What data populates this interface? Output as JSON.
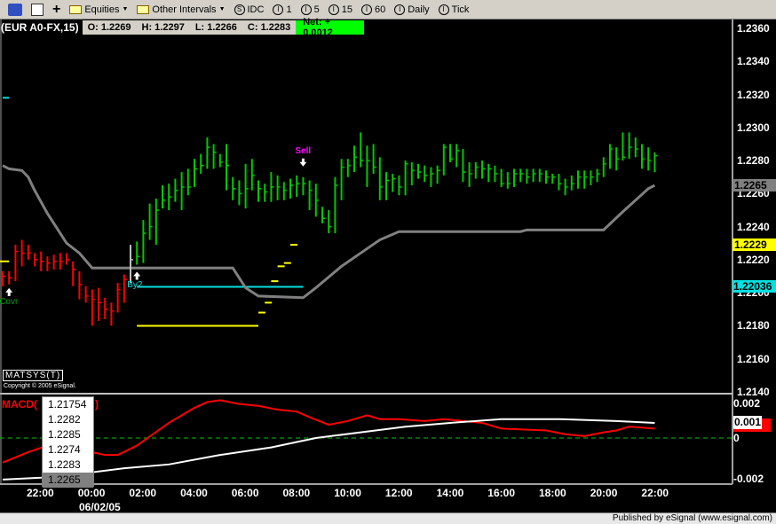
{
  "toolbar": {
    "items": [
      {
        "icon": "link-icon",
        "label": ""
      },
      {
        "icon": "properties-icon",
        "label": ""
      },
      {
        "icon": "plus-icon",
        "label": "+"
      },
      {
        "icon": "folder-icon",
        "label": "Equities",
        "dropdown": true
      },
      {
        "icon": "folder-icon",
        "label": "Other Intervals",
        "dropdown": true
      },
      {
        "icon": "circle-s-icon",
        "glyph": "S",
        "label": "IDC"
      },
      {
        "icon": "circle-i-icon",
        "glyph": "I",
        "label": "1"
      },
      {
        "icon": "circle-i-icon",
        "glyph": "I",
        "label": "5"
      },
      {
        "icon": "circle-i-icon",
        "glyph": "I",
        "label": "15"
      },
      {
        "icon": "circle-i-icon",
        "glyph": "I",
        "label": "60"
      },
      {
        "icon": "circle-i-icon",
        "glyph": "I",
        "label": "Daily"
      },
      {
        "icon": "circle-i-icon",
        "glyph": "I",
        "label": "Tick"
      }
    ]
  },
  "header": {
    "symbol": "(EUR A0-FX,15)",
    "open": "O:  1.2269",
    "high": "H:  1.2297",
    "low": "L:  1.2266",
    "close": "C:  1.2283",
    "net": "Net: + 0.0012"
  },
  "study_label": "MATSYS(T)",
  "copyright": "Copyright © 2005 eSignal.",
  "macd_label_start": "MACD(",
  "macd_label_end": ")",
  "popup": {
    "items": [
      "1.21754",
      "1.2282",
      "1.2285",
      "1.2274",
      "1.2283",
      "1.2265"
    ],
    "selected": 5
  },
  "status": "Published by eSignal (www.esignal.com)",
  "colors": {
    "up": "#00c800",
    "down": "#ff0000",
    "neutral": "#c0c0c0",
    "stop": "#808080",
    "cyan": "#00e0e0",
    "yellow": "#ffff00",
    "macd": "#ff0000",
    "signal": "#ffffff",
    "zero": "#00c800"
  },
  "chart_data": [
    {
      "type": "ohlc",
      "interval": "15",
      "bar_start": "06/01 20:30",
      "price_axis": {
        "ylim": [
          1.214,
          1.236
        ],
        "ticks": [
          "1.2360",
          "1.2340",
          "1.2320",
          "1.2300",
          "1.2280",
          "1.2260",
          "1.2240",
          "1.2220",
          "1.2200",
          "1.2180",
          "1.2160",
          "1.2140"
        ]
      },
      "time_axis": {
        "ticks": [
          "22:00",
          "00:00",
          "02:00",
          "04:00",
          "06:00",
          "08:00",
          "10:00",
          "12:00",
          "14:00",
          "16:00",
          "18:00",
          "20:00",
          "22:00"
        ],
        "date_label": "06/02/05"
      },
      "bars": [
        [
          1.2213,
          1.2204,
          1.221
        ],
        [
          1.2213,
          1.2205,
          1.2209
        ],
        [
          1.2229,
          1.2207,
          1.2225
        ],
        [
          1.2232,
          1.2216,
          1.2224
        ],
        [
          1.2229,
          1.222,
          1.2224
        ],
        [
          1.2224,
          1.2216,
          1.222
        ],
        [
          1.2225,
          1.2213,
          1.2219
        ],
        [
          1.2222,
          1.2213,
          1.2218
        ],
        [
          1.2223,
          1.2214,
          1.2219
        ],
        [
          1.2224,
          1.2214,
          1.2219
        ],
        [
          1.2224,
          1.2217,
          1.222
        ],
        [
          1.2219,
          1.2204,
          1.2214
        ],
        [
          1.2213,
          1.2196,
          1.2205
        ],
        [
          1.2204,
          1.2194,
          1.2198
        ],
        [
          1.2202,
          1.218,
          1.2196
        ],
        [
          1.2203,
          1.2183,
          1.2194
        ],
        [
          1.2197,
          1.2184,
          1.219
        ],
        [
          1.2194,
          1.218,
          1.2189
        ],
        [
          1.2206,
          1.2188,
          1.2202
        ],
        [
          1.2211,
          1.2194,
          1.2208
        ],
        [
          1.2229,
          1.2206,
          1.222
        ],
        [
          1.2231,
          1.2217,
          1.2222
        ],
        [
          1.2244,
          1.2218,
          1.2236
        ],
        [
          1.2254,
          1.2232,
          1.224
        ],
        [
          1.2257,
          1.2229,
          1.225
        ],
        [
          1.2265,
          1.2251,
          1.2256
        ],
        [
          1.2266,
          1.225,
          1.2258
        ],
        [
          1.2269,
          1.2255,
          1.2262
        ],
        [
          1.2273,
          1.225,
          1.2264
        ],
        [
          1.2275,
          1.2259,
          1.2264
        ],
        [
          1.2281,
          1.2264,
          1.2275
        ],
        [
          1.2284,
          1.2272,
          1.2277
        ],
        [
          1.2294,
          1.2275,
          1.2288
        ],
        [
          1.229,
          1.2275,
          1.2285
        ],
        [
          1.2284,
          1.2276,
          1.2279
        ],
        [
          1.229,
          1.2262,
          1.2277
        ],
        [
          1.227,
          1.2256,
          1.2263
        ],
        [
          1.2268,
          1.2253,
          1.226
        ],
        [
          1.2278,
          1.2251,
          1.2263
        ],
        [
          1.2281,
          1.2262,
          1.2271
        ],
        [
          1.2268,
          1.2255,
          1.2263
        ],
        [
          1.2266,
          1.2255,
          1.2261
        ],
        [
          1.2273,
          1.2255,
          1.2264
        ],
        [
          1.2271,
          1.2256,
          1.2264
        ],
        [
          1.2267,
          1.2256,
          1.2262
        ],
        [
          1.2269,
          1.2257,
          1.2265
        ],
        [
          1.2271,
          1.2258,
          1.2266
        ],
        [
          1.227,
          1.2259,
          1.2266
        ],
        [
          1.2268,
          1.225,
          1.2262
        ],
        [
          1.2266,
          1.2246,
          1.2256
        ],
        [
          1.2252,
          1.2242,
          1.2245
        ],
        [
          1.225,
          1.2236,
          1.224
        ],
        [
          1.227,
          1.2236,
          1.2265
        ],
        [
          1.2281,
          1.2256,
          1.2276
        ],
        [
          1.2281,
          1.227,
          1.2277
        ],
        [
          1.2289,
          1.2273,
          1.2282
        ],
        [
          1.2297,
          1.2276,
          1.228
        ],
        [
          1.2289,
          1.2264,
          1.228
        ],
        [
          1.229,
          1.2272,
          1.2276
        ],
        [
          1.2282,
          1.2256,
          1.2264
        ],
        [
          1.2273,
          1.2256,
          1.2268
        ],
        [
          1.2272,
          1.2261,
          1.2269
        ],
        [
          1.2271,
          1.2259,
          1.2264
        ],
        [
          1.228,
          1.2259,
          1.2278
        ],
        [
          1.2279,
          1.2265,
          1.2274
        ],
        [
          1.2278,
          1.2269,
          1.2273
        ],
        [
          1.2277,
          1.2267,
          1.2271
        ],
        [
          1.2276,
          1.2264,
          1.2272
        ],
        [
          1.2277,
          1.2266,
          1.2274
        ],
        [
          1.229,
          1.2271,
          1.2288
        ],
        [
          1.229,
          1.2279,
          1.2281
        ],
        [
          1.229,
          1.2276,
          1.2286
        ],
        [
          1.2287,
          1.2267,
          1.2273
        ],
        [
          1.2279,
          1.2264,
          1.2272
        ],
        [
          1.2279,
          1.2269,
          1.2276
        ],
        [
          1.228,
          1.2269,
          1.2275
        ],
        [
          1.2278,
          1.2267,
          1.2275
        ],
        [
          1.2277,
          1.2267,
          1.2272
        ],
        [
          1.2275,
          1.2264,
          1.2266
        ],
        [
          1.2273,
          1.2263,
          1.2266
        ],
        [
          1.2275,
          1.2264,
          1.2272
        ],
        [
          1.2275,
          1.2267,
          1.2272
        ],
        [
          1.2275,
          1.2266,
          1.227
        ],
        [
          1.2275,
          1.2267,
          1.2272
        ],
        [
          1.2275,
          1.2267,
          1.2272
        ],
        [
          1.2274,
          1.2266,
          1.227
        ],
        [
          1.2272,
          1.2266,
          1.227
        ],
        [
          1.2272,
          1.2262,
          1.2266
        ],
        [
          1.2269,
          1.2259,
          1.2264
        ],
        [
          1.2271,
          1.2262,
          1.2266
        ],
        [
          1.2274,
          1.2263,
          1.227
        ],
        [
          1.2274,
          1.2263,
          1.227
        ],
        [
          1.2274,
          1.2265,
          1.227
        ],
        [
          1.2275,
          1.2267,
          1.2272
        ],
        [
          1.2282,
          1.227,
          1.2278
        ],
        [
          1.229,
          1.2275,
          1.2287
        ],
        [
          1.2288,
          1.2274,
          1.2281
        ],
        [
          1.2297,
          1.228,
          1.2282
        ],
        [
          1.2297,
          1.2281,
          1.2288
        ],
        [
          1.2294,
          1.2282,
          1.2287
        ],
        [
          1.229,
          1.2275,
          1.2281
        ],
        [
          1.2288,
          1.2274,
          1.228
        ],
        [
          1.2285,
          1.2273,
          1.2283
        ]
      ],
      "bar_color_segments": [
        {
          "from": 0,
          "to": 19,
          "color": "down"
        },
        {
          "from": 20,
          "to": 20,
          "color": "neutral"
        },
        {
          "from": 21,
          "to": 102,
          "color": "up"
        }
      ],
      "stop_line": [
        [
          "06/01 20:30",
          1.2277
        ],
        [
          "06/01 20:45",
          1.2275
        ],
        [
          "06/01 21:15",
          1.2274
        ],
        [
          "06/01 21:30",
          1.227
        ],
        [
          "06/01 21:45",
          1.2262
        ],
        [
          "06/01 22:15",
          1.2248
        ],
        [
          "06/01 22:30",
          1.2242
        ],
        [
          "06/01 23:00",
          1.223
        ],
        [
          "06/01 23:30",
          1.2224
        ],
        [
          "06/02 00:00",
          1.2215
        ],
        [
          "06/02 05:30",
          1.2215
        ],
        [
          "06/02 06:00",
          1.2203
        ],
        [
          "06/02 06:30",
          1.2198
        ],
        [
          "06/02 08:15",
          1.2197
        ],
        [
          "06/02 08:45",
          1.2203
        ],
        [
          "06/02 09:45",
          1.2216
        ],
        [
          "06/02 10:30",
          1.2224
        ],
        [
          "06/02 11:15",
          1.2232
        ],
        [
          "06/02 12:00",
          1.2237
        ],
        [
          "06/02 16:45",
          1.2237
        ],
        [
          "06/02 17:00",
          1.2238
        ],
        [
          "06/02 20:00",
          1.2238
        ],
        [
          "06/02 20:45",
          1.2249
        ],
        [
          "06/02 21:15",
          1.2256
        ],
        [
          "06/02 21:45",
          1.2263
        ],
        [
          "06/02 22:00",
          1.2265
        ]
      ],
      "cyan_level": {
        "price": 1.22036,
        "from": "06/02 01:45",
        "to": "06/02 08:15",
        "label": "1.22036"
      },
      "cyan_mark": {
        "price": 1.2318,
        "from": "06/01 20:30",
        "to": "06/01 20:45"
      },
      "yellow_level": {
        "price": 1.218,
        "from": "06/02 01:45",
        "to": "06/02 06:30"
      },
      "yellow_left": {
        "price": 1.2219,
        "from": "06/01 20:15",
        "to": "06/01 20:45"
      },
      "yellow_steps": [
        [
          "06/02 06:30",
          1.2188
        ],
        [
          "06/02 06:45",
          1.2194
        ],
        [
          "06/02 07:00",
          1.2207
        ],
        [
          "06/02 07:15",
          1.2216
        ],
        [
          "06/02 07:30",
          1.2218
        ],
        [
          "06/02 07:45",
          1.2229
        ]
      ],
      "last_price_label": "1.2265",
      "yellow_label": "1.2229",
      "signals": [
        {
          "time": "06/01 20:45",
          "text": "Covr",
          "dir": "up",
          "color": "#00a000"
        },
        {
          "time": "06/02 01:45",
          "text": "By2",
          "dir": "up",
          "color": "#00e0e0"
        },
        {
          "time": "06/02 08:15",
          "text": "Sell",
          "dir": "down",
          "color": "#ff00ff"
        }
      ]
    },
    {
      "type": "line",
      "title": "MACD",
      "y_ticks": [
        "0.002",
        "0",
        "-0.002"
      ],
      "ylim": [
        -0.0023,
        0.0023
      ],
      "value_label": "0.001",
      "series": [
        {
          "role": "macd",
          "points": [
            [
              "06/01 20:30",
              -0.0013
            ],
            [
              "06/01 21:30",
              -0.00075
            ],
            [
              "06/01 22:15",
              -0.0004
            ],
            [
              "06/01 23:00",
              -0.0004
            ],
            [
              "06/02 00:00",
              -0.00075
            ],
            [
              "06/02 00:30",
              -0.0009
            ],
            [
              "06/02 01:00",
              -0.0009
            ],
            [
              "06/02 01:45",
              -0.0004
            ],
            [
              "06/02 03:00",
              0.0008
            ],
            [
              "06/02 04:00",
              0.0016
            ],
            [
              "06/02 04:30",
              0.0019
            ],
            [
              "06/02 05:00",
              0.002
            ],
            [
              "06/02 05:45",
              0.0018
            ],
            [
              "06/02 06:30",
              0.0017
            ],
            [
              "06/02 07:15",
              0.0015
            ],
            [
              "06/02 08:00",
              0.0014
            ],
            [
              "06/02 08:30",
              0.0011
            ],
            [
              "06/02 09:15",
              0.0007
            ],
            [
              "06/02 10:00",
              0.0009
            ],
            [
              "06/02 10:45",
              0.0012
            ],
            [
              "06/02 11:15",
              0.001
            ],
            [
              "06/02 12:00",
              0.001
            ],
            [
              "06/02 13:00",
              0.0009
            ],
            [
              "06/02 13:45",
              0.001
            ],
            [
              "06/02 14:30",
              0.0009
            ],
            [
              "06/02 15:15",
              0.0008
            ],
            [
              "06/02 16:00",
              0.0005
            ],
            [
              "06/02 17:45",
              0.0004
            ],
            [
              "06/02 18:30",
              0.0002
            ],
            [
              "06/02 19:15",
              0.0001
            ],
            [
              "06/02 20:00",
              0.0003
            ],
            [
              "06/02 20:30",
              0.0004
            ],
            [
              "06/02 21:00",
              0.0006
            ],
            [
              "06/02 22:00",
              0.0005
            ]
          ]
        },
        {
          "role": "signal",
          "points": [
            [
              "06/01 20:30",
              -0.0022
            ],
            [
              "06/01 22:00",
              -0.0021
            ],
            [
              "06/01 23:30",
              -0.0019
            ],
            [
              "06/02 01:15",
              -0.0016
            ],
            [
              "06/02 03:00",
              -0.0014
            ],
            [
              "06/02 05:00",
              -0.0009
            ],
            [
              "06/02 07:00",
              -0.0005
            ],
            [
              "06/02 08:45",
              0.0
            ],
            [
              "06/02 10:30",
              0.0003
            ],
            [
              "06/02 12:15",
              0.0006
            ],
            [
              "06/02 14:00",
              0.0008
            ],
            [
              "06/02 16:00",
              0.001
            ],
            [
              "06/02 17:15",
              0.001
            ],
            [
              "06/02 18:15",
              0.001
            ],
            [
              "06/02 20:30",
              0.0009
            ],
            [
              "06/02 22:00",
              0.0008
            ]
          ]
        }
      ]
    }
  ]
}
